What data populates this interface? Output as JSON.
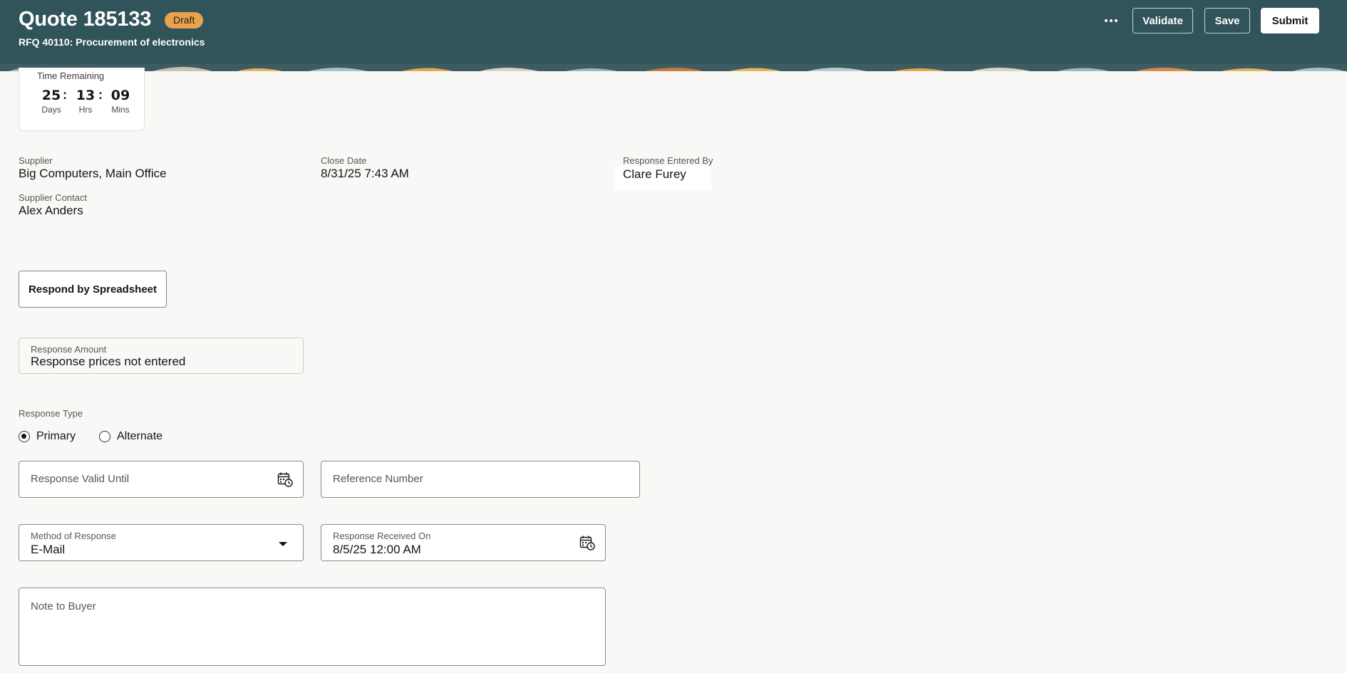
{
  "header": {
    "title": "Quote 185133",
    "status_badge": "Draft",
    "subtitle": "RFQ 40110: Procurement of electronics",
    "actions": {
      "more_icon": "ellipsis-icon",
      "validate_label": "Validate",
      "save_label": "Save",
      "submit_label": "Submit"
    },
    "colors": {
      "background": "#31535a",
      "badge": "#e9a24e"
    }
  },
  "timer": {
    "label": "Time Remaining",
    "days": "25",
    "hours": "13",
    "minutes": "09",
    "separator": ":",
    "days_unit": "Days",
    "hours_unit": "Hrs",
    "minutes_unit": "Mins"
  },
  "details": {
    "supplier_label": "Supplier",
    "supplier_value": "Big Computers, Main Office",
    "close_date_label": "Close Date",
    "close_date_value": "8/31/25 7:43 AM",
    "entered_by_label": "Response Entered By",
    "entered_by_value": "Clare Furey",
    "contact_label": "Supplier Contact",
    "contact_value": "Alex Anders"
  },
  "spreadsheet_button": "Respond by Spreadsheet",
  "response_amount": {
    "label": "Response Amount",
    "value": "Response prices not entered"
  },
  "response_type": {
    "label": "Response Type",
    "options": [
      "Primary",
      "Alternate"
    ],
    "selected": "Primary"
  },
  "form": {
    "valid_until_placeholder": "Response Valid Until",
    "reference_number_placeholder": "Reference Number",
    "method_label": "Method of Response",
    "method_value": "E-Mail",
    "received_on_label": "Response Received On",
    "received_on_value": "8/5/25 12:00 AM",
    "note_placeholder": "Note to Buyer",
    "calendar_icon": "calendar-clock-icon",
    "dropdown_icon": "caret-down-icon"
  }
}
